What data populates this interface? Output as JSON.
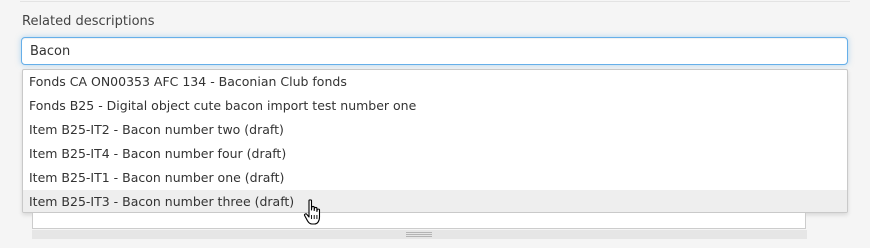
{
  "field": {
    "label": "Related descriptions",
    "value": "Bacon"
  },
  "autocomplete": {
    "options": [
      "Fonds CA ON00353 AFC 134 - Baconian Club fonds",
      "Fonds B25 - Digital object cute bacon import test number one",
      "Item B25-IT2 - Bacon number two (draft)",
      "Item B25-IT4 - Bacon number four (draft)",
      "Item B25-IT1 - Bacon number one (draft)",
      "Item B25-IT3 - Bacon number three (draft)"
    ],
    "highlighted_index": 5
  },
  "icons": {
    "cursor": "hand-pointer-icon",
    "resize_handle": "resize-grip-icon"
  },
  "colors": {
    "focus_border": "#66afe9",
    "highlight_bg": "#eeeeee",
    "panel_bg": "#f5f5f5"
  }
}
